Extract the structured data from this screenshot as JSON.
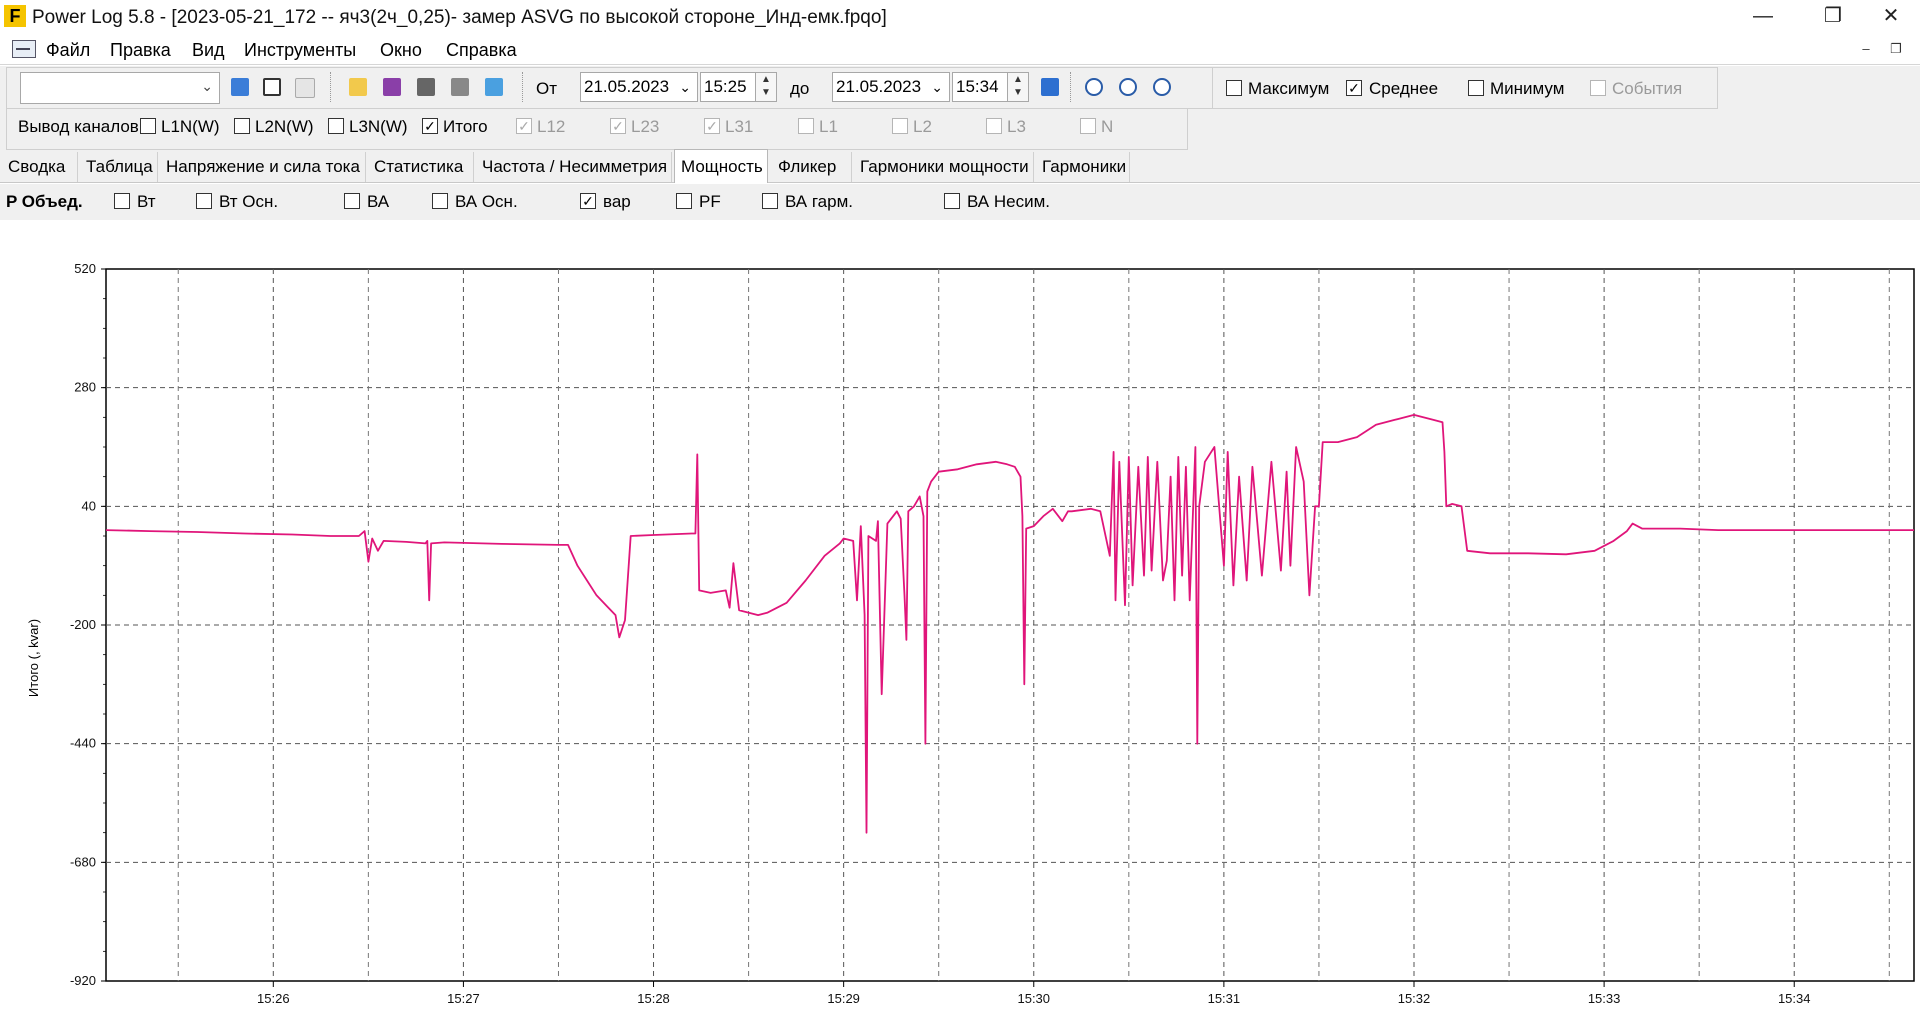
{
  "window": {
    "title": "Power Log 5.8 - [2023-05-21_172 -- яч3(2ч_0,25)- замер ASVG по высокой стороне_Инд-емк.fpqo]",
    "logo_letter": "F",
    "controls": [
      "minimize-icon",
      "restore-icon",
      "close-icon"
    ]
  },
  "menu": {
    "items": [
      "Файл",
      "Правка",
      "Вид",
      "Инструменты",
      "Окно",
      "Справка"
    ]
  },
  "toolbar": {
    "from_label": "От",
    "from_date": "21.05.2023",
    "from_time": "15:25",
    "to_label": "до",
    "to_date": "21.05.2023",
    "to_time": "15:34",
    "options": [
      {
        "label": "Максимум",
        "checked": false,
        "enabled": true
      },
      {
        "label": "Среднее",
        "checked": true,
        "enabled": true
      },
      {
        "label": "Минимум",
        "checked": false,
        "enabled": true
      },
      {
        "label": "События",
        "checked": false,
        "enabled": false
      }
    ],
    "channels_label": "Вывод каналов",
    "channels": [
      {
        "label": "L1N(W)",
        "checked": false,
        "enabled": true
      },
      {
        "label": "L2N(W)",
        "checked": false,
        "enabled": true
      },
      {
        "label": "L3N(W)",
        "checked": false,
        "enabled": true
      },
      {
        "label": "Итого",
        "checked": true,
        "enabled": true
      },
      {
        "label": "L12",
        "checked": true,
        "enabled": false
      },
      {
        "label": "L23",
        "checked": true,
        "enabled": false
      },
      {
        "label": "L31",
        "checked": true,
        "enabled": false
      },
      {
        "label": "L1",
        "checked": false,
        "enabled": false
      },
      {
        "label": "L2",
        "checked": false,
        "enabled": false
      },
      {
        "label": "L3",
        "checked": false,
        "enabled": false
      },
      {
        "label": "N",
        "checked": false,
        "enabled": false
      }
    ]
  },
  "tabs": [
    {
      "label": "Сводка",
      "active": false
    },
    {
      "label": "Таблица",
      "active": false
    },
    {
      "label": "Напряжение и сила тока",
      "active": false
    },
    {
      "label": "Статистика",
      "active": false
    },
    {
      "label": "Частота / Несимметрия",
      "active": false
    },
    {
      "label": "Мощность",
      "active": true
    },
    {
      "label": "Фликер",
      "active": false
    },
    {
      "label": "Гармоники мощности",
      "active": false
    },
    {
      "label": "Гармоники",
      "active": false
    }
  ],
  "power_options": {
    "group_label": "P Объед.",
    "items": [
      {
        "label": "Вт",
        "checked": false
      },
      {
        "label": "Вт Осн.",
        "checked": false
      },
      {
        "label": "ВА",
        "checked": false
      },
      {
        "label": "ВА Осн.",
        "checked": false
      },
      {
        "label": "вар",
        "checked": true
      },
      {
        "label": "PF",
        "checked": false
      },
      {
        "label": "ВА гарм.",
        "checked": false
      },
      {
        "label": "ВА Несим.",
        "checked": false
      }
    ]
  },
  "chart_data": {
    "type": "line",
    "title": "",
    "xlabel": "",
    "ylabel": "Итого (, kvar)",
    "x_tick_labels": [
      "15:26",
      "15:27",
      "15:28",
      "15:29",
      "15:30",
      "15:31",
      "15:32",
      "15:33",
      "15:34"
    ],
    "y_tick_labels": [
      "520",
      "280",
      "40",
      "-200",
      "-440",
      "-680",
      "-920"
    ],
    "ylim": [
      -920,
      520
    ],
    "xlim_minutes": [
      25.12,
      34.63
    ],
    "grid": true,
    "series_color": "#e0157a",
    "series": [
      {
        "name": "",
        "points": [
          [
            25.12,
            -8
          ],
          [
            25.35,
            -10
          ],
          [
            25.6,
            -12
          ],
          [
            25.85,
            -15
          ],
          [
            26.1,
            -17
          ],
          [
            26.3,
            -20
          ],
          [
            26.45,
            -20
          ],
          [
            26.48,
            -10
          ],
          [
            26.5,
            -72
          ],
          [
            26.52,
            -25
          ],
          [
            26.55,
            -50
          ],
          [
            26.58,
            -30
          ],
          [
            26.7,
            -32
          ],
          [
            26.8,
            -35
          ],
          [
            26.81,
            -30
          ],
          [
            26.82,
            -150
          ],
          [
            26.83,
            -35
          ],
          [
            26.9,
            -33
          ],
          [
            27.2,
            -36
          ],
          [
            27.5,
            -38
          ],
          [
            27.55,
            -38
          ],
          [
            27.6,
            -80
          ],
          [
            27.65,
            -110
          ],
          [
            27.7,
            -140
          ],
          [
            27.75,
            -160
          ],
          [
            27.8,
            -180
          ],
          [
            27.82,
            -225
          ],
          [
            27.85,
            -190
          ],
          [
            27.88,
            -20
          ],
          [
            28.0,
            -18
          ],
          [
            28.2,
            -15
          ],
          [
            28.22,
            -15
          ],
          [
            28.23,
            145
          ],
          [
            28.24,
            -130
          ],
          [
            28.3,
            -135
          ],
          [
            28.38,
            -130
          ],
          [
            28.4,
            -165
          ],
          [
            28.42,
            -75
          ],
          [
            28.45,
            -170
          ],
          [
            28.55,
            -180
          ],
          [
            28.6,
            -175
          ],
          [
            28.7,
            -155
          ],
          [
            28.8,
            -110
          ],
          [
            28.9,
            -60
          ],
          [
            28.98,
            -35
          ],
          [
            29.0,
            -25
          ],
          [
            29.05,
            -30
          ],
          [
            29.07,
            -150
          ],
          [
            29.09,
            0
          ],
          [
            29.11,
            -180
          ],
          [
            29.12,
            -620
          ],
          [
            29.13,
            -20
          ],
          [
            29.17,
            -30
          ],
          [
            29.18,
            10
          ],
          [
            29.2,
            -340
          ],
          [
            29.23,
            5
          ],
          [
            29.28,
            30
          ],
          [
            29.3,
            15
          ],
          [
            29.32,
            -140
          ],
          [
            29.33,
            -230
          ],
          [
            29.34,
            30
          ],
          [
            29.37,
            40
          ],
          [
            29.4,
            60
          ],
          [
            29.42,
            20
          ],
          [
            29.43,
            -440
          ],
          [
            29.44,
            70
          ],
          [
            29.46,
            90
          ],
          [
            29.5,
            110
          ],
          [
            29.6,
            115
          ],
          [
            29.7,
            125
          ],
          [
            29.8,
            130
          ],
          [
            29.86,
            125
          ],
          [
            29.9,
            120
          ],
          [
            29.93,
            100
          ],
          [
            29.94,
            20
          ],
          [
            29.95,
            -320
          ],
          [
            29.96,
            -5
          ],
          [
            30.0,
            0
          ],
          [
            30.05,
            20
          ],
          [
            30.1,
            35
          ],
          [
            30.15,
            10
          ],
          [
            30.18,
            30
          ],
          [
            30.2,
            30
          ],
          [
            30.3,
            35
          ],
          [
            30.35,
            30
          ],
          [
            30.4,
            -60
          ],
          [
            30.42,
            150
          ],
          [
            30.43,
            -150
          ],
          [
            30.45,
            130
          ],
          [
            30.48,
            -160
          ],
          [
            30.5,
            140
          ],
          [
            30.52,
            -120
          ],
          [
            30.55,
            120
          ],
          [
            30.58,
            -100
          ],
          [
            30.6,
            140
          ],
          [
            30.62,
            -90
          ],
          [
            30.65,
            130
          ],
          [
            30.68,
            -110
          ],
          [
            30.7,
            -70
          ],
          [
            30.72,
            100
          ],
          [
            30.74,
            -150
          ],
          [
            30.76,
            140
          ],
          [
            30.78,
            -100
          ],
          [
            30.8,
            120
          ],
          [
            30.82,
            -150
          ],
          [
            30.85,
            160
          ],
          [
            30.86,
            -440
          ],
          [
            30.87,
            40
          ],
          [
            30.9,
            130
          ],
          [
            30.95,
            160
          ],
          [
            31.0,
            -80
          ],
          [
            31.02,
            150
          ],
          [
            31.05,
            -120
          ],
          [
            31.08,
            100
          ],
          [
            31.12,
            -110
          ],
          [
            31.15,
            120
          ],
          [
            31.2,
            -100
          ],
          [
            31.25,
            130
          ],
          [
            31.3,
            -90
          ],
          [
            31.33,
            110
          ],
          [
            31.35,
            -80
          ],
          [
            31.38,
            160
          ],
          [
            31.42,
            90
          ],
          [
            31.45,
            -140
          ],
          [
            31.48,
            40
          ],
          [
            31.5,
            40
          ],
          [
            31.52,
            170
          ],
          [
            31.6,
            170
          ],
          [
            31.7,
            180
          ],
          [
            31.8,
            205
          ],
          [
            31.9,
            215
          ],
          [
            32.0,
            225
          ],
          [
            32.1,
            215
          ],
          [
            32.15,
            210
          ],
          [
            32.16,
            150
          ],
          [
            32.17,
            40
          ],
          [
            32.2,
            45
          ],
          [
            32.25,
            40
          ],
          [
            32.28,
            -50
          ],
          [
            32.4,
            -55
          ],
          [
            32.6,
            -55
          ],
          [
            32.8,
            -57
          ],
          [
            32.95,
            -50
          ],
          [
            33.05,
            -30
          ],
          [
            33.12,
            -10
          ],
          [
            33.15,
            5
          ],
          [
            33.2,
            -5
          ],
          [
            33.4,
            -5
          ],
          [
            33.6,
            -8
          ],
          [
            33.8,
            -8
          ],
          [
            34.0,
            -8
          ],
          [
            34.2,
            -8
          ],
          [
            34.4,
            -8
          ],
          [
            34.63,
            -8
          ]
        ]
      }
    ]
  }
}
